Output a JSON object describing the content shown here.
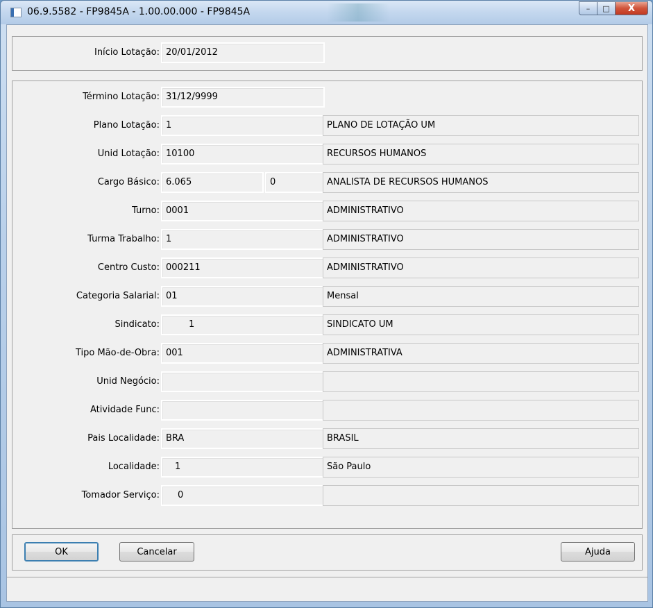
{
  "window": {
    "title": "06.9.5582 - FP9845A - 1.00.00.000 - FP9845A",
    "controls": {
      "minimize": "–",
      "maximize": "□",
      "close": "X"
    }
  },
  "header": {
    "inicio_label": "Início Lotação:",
    "inicio_value": "20/01/2012"
  },
  "form": {
    "termino": {
      "label": "Término Lotação:",
      "value": "31/12/9999"
    },
    "plano": {
      "label": "Plano Lotação:",
      "code": "1",
      "desc": "PLANO DE LOTAÇÃO UM"
    },
    "unid": {
      "label": "Unid Lotação:",
      "code": "10100",
      "desc": "RECURSOS HUMANOS"
    },
    "cargo": {
      "label": "Cargo Básico:",
      "code": "6.065",
      "extra": "0",
      "desc": "ANALISTA DE RECURSOS HUMANOS"
    },
    "turno": {
      "label": "Turno:",
      "code": "0001",
      "desc": "ADMINISTRATIVO"
    },
    "turma": {
      "label": "Turma Trabalho:",
      "code": "1",
      "desc": "ADMINISTRATIVO"
    },
    "centro": {
      "label": "Centro Custo:",
      "code": "000211",
      "desc": "ADMINISTRATIVO"
    },
    "categoria": {
      "label": "Categoria Salarial:",
      "code": "01",
      "desc": "Mensal"
    },
    "sindicato": {
      "label": "Sindicato:",
      "code": "1",
      "desc": "SINDICATO UM"
    },
    "tipo": {
      "label": "Tipo Mão-de-Obra:",
      "code": "001",
      "desc": "ADMINISTRATIVA"
    },
    "negocio": {
      "label": "Unid Negócio:",
      "code": "",
      "desc": ""
    },
    "atividade": {
      "label": "Atividade Func:",
      "code": "",
      "desc": ""
    },
    "pais": {
      "label": "Pais Localidade:",
      "code": "BRA",
      "desc": "BRASIL"
    },
    "localidade": {
      "label": "Localidade:",
      "code": "1",
      "desc": "São Paulo"
    },
    "tomador": {
      "label": "Tomador Serviço:",
      "code": "0",
      "desc": ""
    }
  },
  "buttons": {
    "ok": "OK",
    "cancel": "Cancelar",
    "help": "Ajuda"
  }
}
